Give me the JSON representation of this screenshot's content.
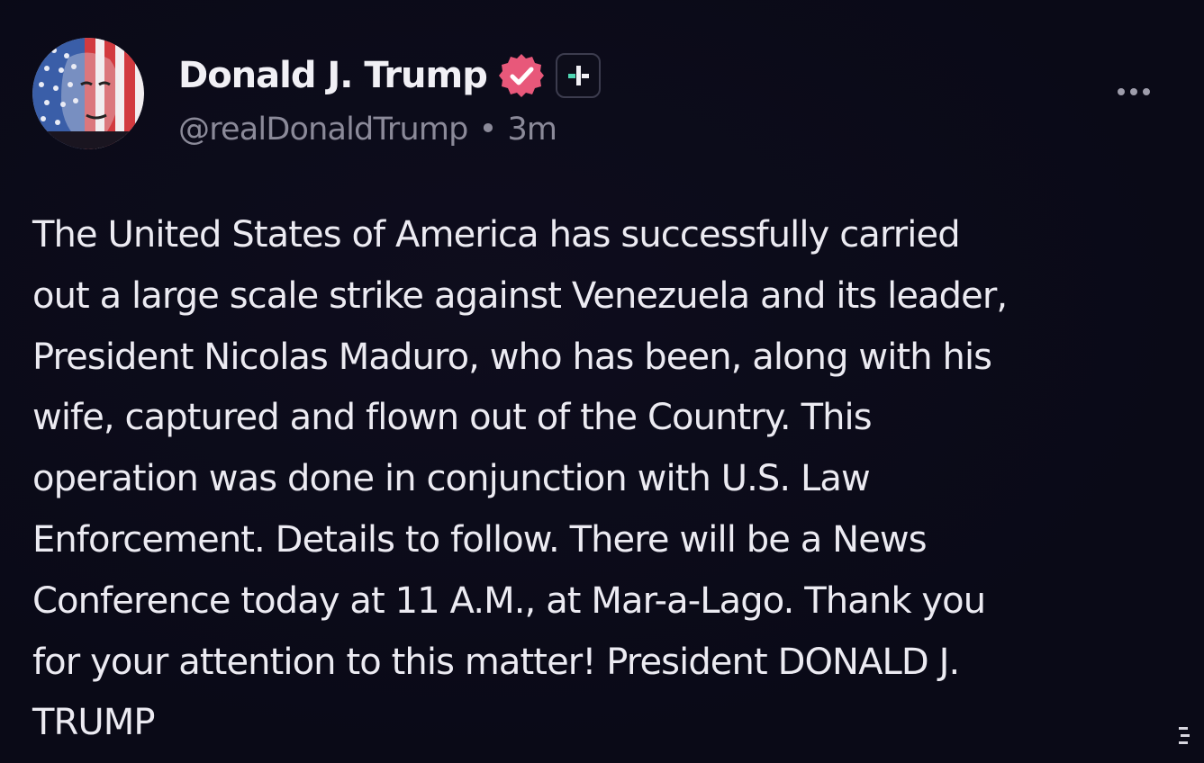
{
  "author": {
    "display_name": "Donald J. Trump",
    "handle": "@realDonaldTrump",
    "separator": "•",
    "timestamp": "3m",
    "verified_icon": "verified-badge-icon",
    "plus_icon": "plus-badge-icon",
    "avatar_icon": "flag-portrait-avatar"
  },
  "post": {
    "lines": [
      "The United States of America has successfully carried",
      "out a large scale strike against Venezuela and its leader,",
      "President Nicolas Maduro, who has been, along with his",
      "wife, captured and flown out of the Country. This",
      "operation was done in conjunction with U.S. Law",
      "Enforcement. Details to follow. There will be a News",
      "Conference today at 11 A.M., at Mar-a-Lago. Thank you",
      "for your attention to this matter! President DONALD J.",
      "TRUMP"
    ]
  },
  "menu": {
    "more_icon": "more-options-icon"
  },
  "colors": {
    "background": "#0a0a17",
    "text": "#ecebf2",
    "muted": "#8b8a99",
    "verified": "#e8587a",
    "plus_accent": "#4fd6b3"
  }
}
